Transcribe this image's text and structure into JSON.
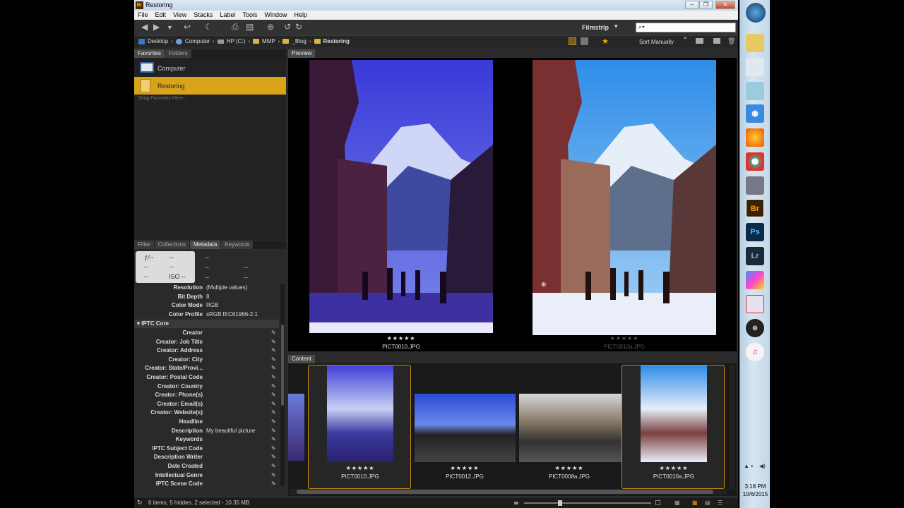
{
  "window": {
    "title": "Restoring",
    "app_icon": "Br"
  },
  "menu": [
    "File",
    "Edit",
    "View",
    "Stacks",
    "Label",
    "Tools",
    "Window",
    "Help"
  ],
  "toolbar": {
    "view_mode": "Filmstrip",
    "search_placeholder": "⌕▾"
  },
  "path": [
    "Desktop",
    "Computer",
    "HP (C:)",
    "MMP",
    "_Blog",
    "Restoring"
  ],
  "sort": "Sort Manually",
  "favorites_tabs": [
    "Favorites",
    "Folders"
  ],
  "favorites": [
    {
      "label": "Computer",
      "icon": "computer-icon"
    },
    {
      "label": "Restoring",
      "icon": "folder-icon",
      "selected": true
    }
  ],
  "favorites_hint": "Drag Favorites Here...",
  "panel_tabs": [
    "Filter",
    "Collections",
    "Metadata",
    "Keywords"
  ],
  "camera_data": {
    "fstop": "ƒ/--",
    "shutter": "--",
    "iso": "ISO --",
    "dash": "--"
  },
  "file_props": [
    {
      "key": "Resolution",
      "value": "(Multiple values)"
    },
    {
      "key": "Bit Depth",
      "value": "8"
    },
    {
      "key": "Color Mode",
      "value": "RGB"
    },
    {
      "key": "Color Profile",
      "value": "sRGB IEC61966-2.1"
    }
  ],
  "iptc_header": "IPTC Core",
  "iptc_fields": [
    {
      "key": "Creator",
      "value": ""
    },
    {
      "key": "Creator: Job Title",
      "value": ""
    },
    {
      "key": "Creator: Address",
      "value": ""
    },
    {
      "key": "Creator: City",
      "value": ""
    },
    {
      "key": "Creator: State/Provi...",
      "value": ""
    },
    {
      "key": "Creator: Postal Code",
      "value": ""
    },
    {
      "key": "Creator: Country",
      "value": ""
    },
    {
      "key": "Creator: Phone(s)",
      "value": ""
    },
    {
      "key": "Creator: Email(s)",
      "value": ""
    },
    {
      "key": "Creator: Website(s)",
      "value": ""
    },
    {
      "key": "Headline",
      "value": ""
    },
    {
      "key": "Description",
      "value": "My beautiful picture"
    },
    {
      "key": "Keywords",
      "value": ""
    },
    {
      "key": "IPTC Subject Code",
      "value": ""
    },
    {
      "key": "Description Writer",
      "value": ""
    },
    {
      "key": "Date Created",
      "value": ""
    },
    {
      "key": "Intellectual Genre",
      "value": ""
    },
    {
      "key": "IPTC Scene Code",
      "value": ""
    }
  ],
  "preview": {
    "tab": "Preview",
    "images": [
      {
        "file": "PICT0010.JPG",
        "rating": "★★★★★"
      },
      {
        "file": "PICT0010a.JPG",
        "rating": "★★★★★"
      }
    ]
  },
  "content": {
    "tab": "Content",
    "items": [
      {
        "file": "PICT0010.JPG",
        "rating": "★★★★★",
        "selected": true
      },
      {
        "file": "PICT0012.JPG",
        "rating": "★★★★★",
        "selected": false
      },
      {
        "file": "PICT0008a.JPG",
        "rating": "★★★★★",
        "selected": false
      },
      {
        "file": "PICT0010a.JPG",
        "rating": "★★★★★",
        "selected": true
      }
    ]
  },
  "status": "6 items, 5 hidden, 2 selected - 10.35 MB",
  "taskbar": {
    "time": "3:18 PM",
    "date": "10/6/2015",
    "apps": [
      "Br",
      "Ps",
      "Lr"
    ]
  }
}
